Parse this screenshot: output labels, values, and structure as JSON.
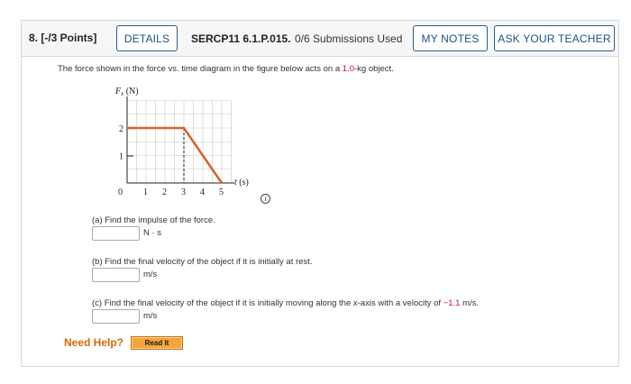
{
  "question": {
    "number_points": "8. [-/3 Points]",
    "details_label": "DETAILS",
    "code": "SERCP11 6.1.P.015.",
    "submissions": "0/6 Submissions Used",
    "my_notes_label": "MY NOTES",
    "ask_teacher_label": "ASK YOUR TEACHER"
  },
  "prompt": {
    "before": "The force shown in the force vs. time diagram in the figure below acts on a ",
    "mass": "1.0",
    "after": "-kg object."
  },
  "graph": {
    "y_axis_label": "Fx (N)",
    "x_axis_label": "t (s)",
    "origin_label": "0",
    "y_ticks": [
      "1",
      "2"
    ],
    "x_ticks": [
      "1",
      "2",
      "3",
      "4",
      "5"
    ],
    "info_icon": "i"
  },
  "chart_data": {
    "type": "line",
    "x": [
      0,
      3,
      5
    ],
    "series": [
      {
        "values": [
          2,
          2,
          0
        ]
      }
    ],
    "xlabel": "t (s)",
    "ylabel": "Fx (N)",
    "xlim": [
      0,
      5.5
    ],
    "ylim": [
      0,
      3
    ],
    "grid": true,
    "color": "#d4632b"
  },
  "parts": {
    "a_label": "(a) Find the impulse of the force.",
    "a_unit": "N · s",
    "b_label": "(b) Find the final velocity of the object if it is initially at rest.",
    "b_unit": "m/s",
    "c_before": "(c) Find the final velocity of the object if it is initially moving along the ",
    "c_axis": "x",
    "c_middle": "-axis with a velocity of ",
    "c_value": "−1.1",
    "c_after": " m/s.",
    "c_unit": "m/s"
  },
  "help": {
    "need_help": "Need Help?",
    "read_it": "Read It"
  }
}
